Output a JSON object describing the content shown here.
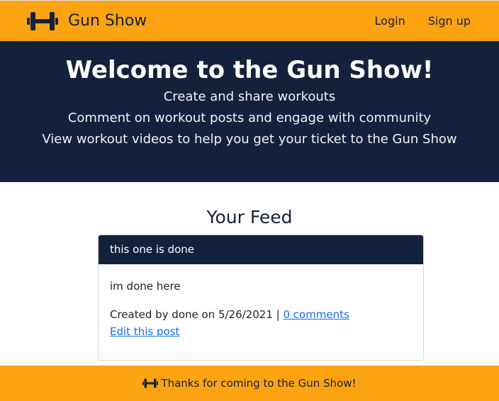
{
  "navbar": {
    "brand": "Gun Show",
    "brand_icon": "dumbbell-icon",
    "links": [
      "Login",
      "Sign up"
    ]
  },
  "hero": {
    "title": "Welcome to the Gun Show!",
    "lines": [
      "Create and share workouts",
      "Comment on workout posts and engage with community",
      "View workout videos to help you get your ticket to the Gun Show"
    ]
  },
  "feed": {
    "title": "Your Feed",
    "posts": [
      {
        "title": "this one is done",
        "body": "im done here",
        "meta_prefix": "Created by done on 5/26/2021 |",
        "comments_link": "0 comments",
        "edit_link": "Edit this post"
      }
    ]
  },
  "footer": {
    "text": "Thanks for coming to the Gun Show!",
    "icon": "dumbbell-icon"
  },
  "colors": {
    "accent": "#fca311",
    "navy": "#14213d",
    "link": "#0d6efd"
  }
}
